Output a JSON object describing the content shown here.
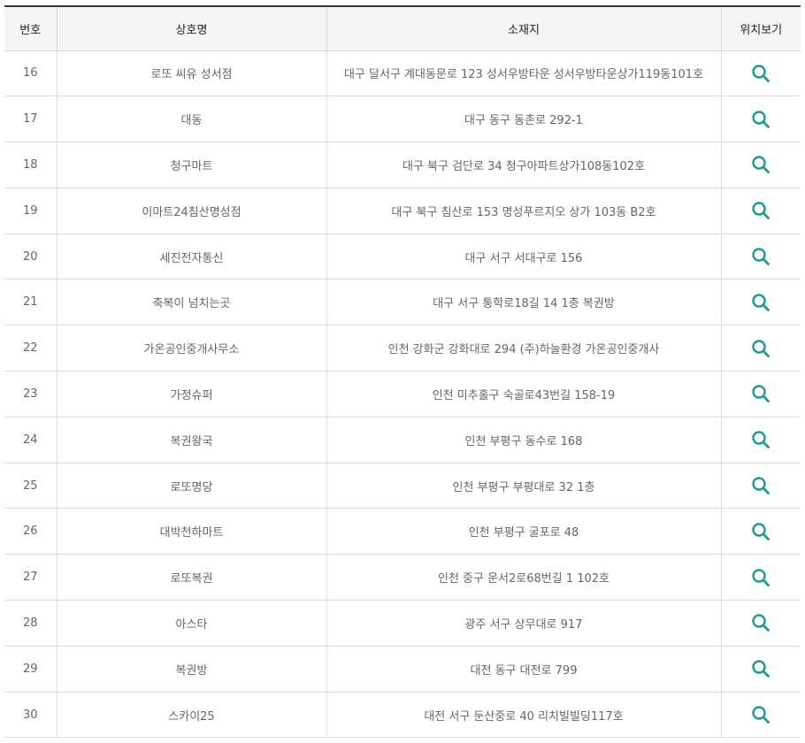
{
  "header": {
    "no": "번호",
    "name": "상호명",
    "address": "소재지",
    "location": "위치보기"
  },
  "accent_color": "#1a9c8c",
  "location_icon": "search-icon",
  "rows": [
    {
      "no": "16",
      "name": "로또 씨유 성서점",
      "address": "대구 달서구 계대동문로 123 성서우방타운 성서우방타운상가119동101호"
    },
    {
      "no": "17",
      "name": "대동",
      "address": "대구 동구 동촌로 292-1"
    },
    {
      "no": "18",
      "name": "청구마트",
      "address": "대구 북구 검단로 34 청구아파트상가108동102호"
    },
    {
      "no": "19",
      "name": "이마트24침산명성점",
      "address": "대구 북구 침산로 153 명성푸르지오 상가 103동 B2호"
    },
    {
      "no": "20",
      "name": "세진전자통신",
      "address": "대구 서구 서대구로 156"
    },
    {
      "no": "21",
      "name": "축복이 넘치는곳",
      "address": "대구 서구 통학로18길 14 1층 복권방"
    },
    {
      "no": "22",
      "name": "가온공인중개사무소",
      "address": "인천 강화군 강화대로 294 (주)하늘환경 가온공인중개사"
    },
    {
      "no": "23",
      "name": "가정슈퍼",
      "address": "인천 미추홀구 숙골로43번길 158-19"
    },
    {
      "no": "24",
      "name": "복권왕국",
      "address": "인천 부평구 동수로 168"
    },
    {
      "no": "25",
      "name": "로또명당",
      "address": "인천 부평구 부평대로 32 1층"
    },
    {
      "no": "26",
      "name": "대박천하마트",
      "address": "인천 부평구 굴포로 48"
    },
    {
      "no": "27",
      "name": "로또복권",
      "address": "인천 중구 운서2로68번길 1 102호"
    },
    {
      "no": "28",
      "name": "아스타",
      "address": "광주 서구 상무대로 917"
    },
    {
      "no": "29",
      "name": "복권방",
      "address": "대전 동구 대전로 799"
    },
    {
      "no": "30",
      "name": "스카이25",
      "address": "대전 서구 둔산중로 40 리치빌빌딩117호"
    }
  ]
}
